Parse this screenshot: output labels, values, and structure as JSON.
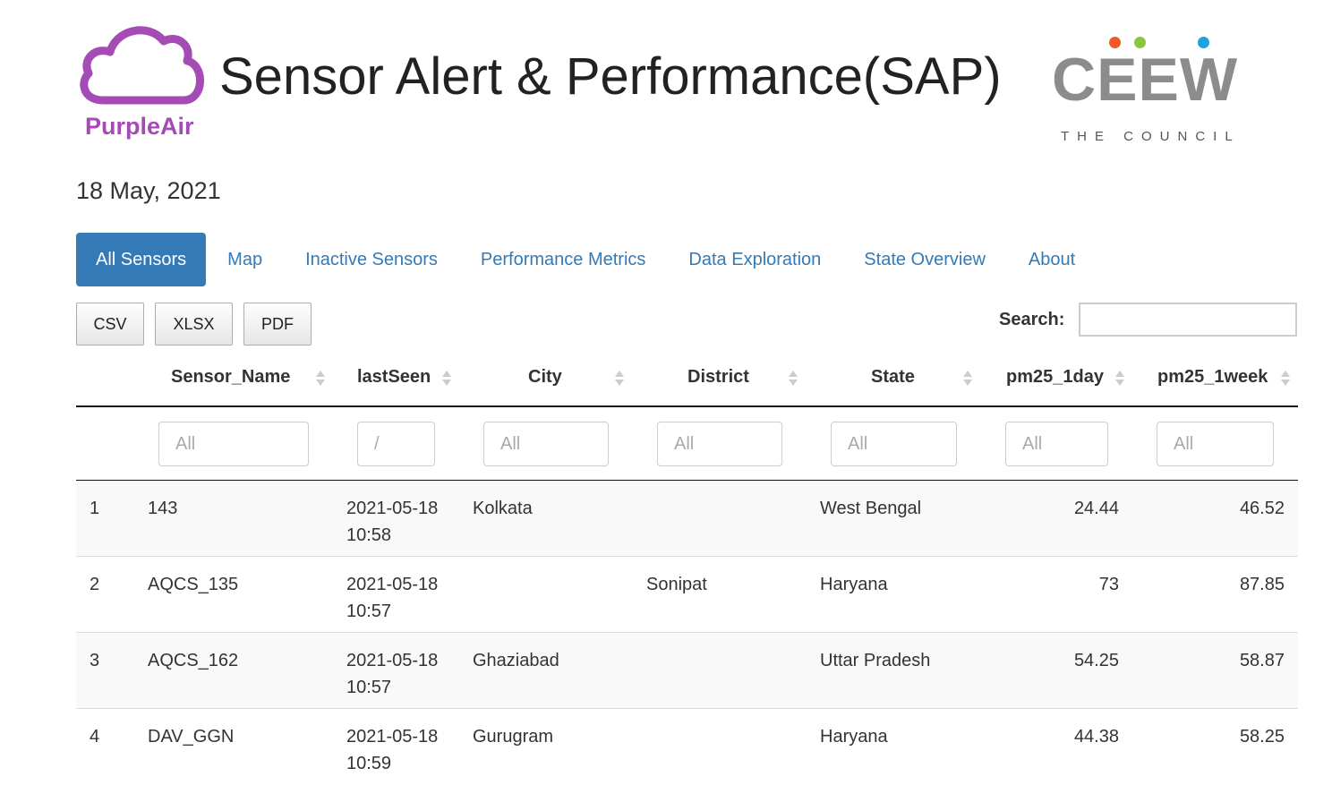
{
  "header": {
    "logo_left_text": "PurpleAir",
    "title": "Sensor Alert & Performance(SAP)",
    "logo_right_word": "CEEW",
    "logo_right_sub": "THE COUNCIL",
    "colors": {
      "purple": "#a54bb5",
      "ceew_grey": "#8c8c8c",
      "dot_orange": "#f05a28",
      "dot_green": "#8cc63f",
      "dot_blue": "#1da1e2"
    }
  },
  "date": "18 May, 2021",
  "tabs": [
    {
      "label": "All Sensors",
      "active": true
    },
    {
      "label": "Map"
    },
    {
      "label": "Inactive Sensors"
    },
    {
      "label": "Performance Metrics"
    },
    {
      "label": "Data Exploration"
    },
    {
      "label": "State Overview"
    },
    {
      "label": "About"
    }
  ],
  "buttons": {
    "csv": "CSV",
    "xlsx": "XLSX",
    "pdf": "PDF"
  },
  "search": {
    "label": "Search:",
    "value": ""
  },
  "table": {
    "columns": [
      "Sensor_Name",
      "lastSeen",
      "City",
      "District",
      "State",
      "pm25_1day",
      "pm25_1week"
    ],
    "filters": [
      "All",
      "/",
      "All",
      "All",
      "All",
      "All",
      "All"
    ],
    "rows": [
      {
        "index": "1",
        "name": "143",
        "date": "2021-05-18",
        "time": "10:58",
        "city": "Kolkata",
        "district": "",
        "state": "West Bengal",
        "pm1d": "24.44",
        "pm1w": "46.52"
      },
      {
        "index": "2",
        "name": "AQCS_135",
        "date": "2021-05-18",
        "time": "10:57",
        "city": "",
        "district": "Sonipat",
        "state": "Haryana",
        "pm1d": "73",
        "pm1w": "87.85"
      },
      {
        "index": "3",
        "name": "AQCS_162",
        "date": "2021-05-18",
        "time": "10:57",
        "city": "Ghaziabad",
        "district": "",
        "state": "Uttar Pradesh",
        "pm1d": "54.25",
        "pm1w": "58.87"
      },
      {
        "index": "4",
        "name": "DAV_GGN",
        "date": "2021-05-18",
        "time": "10:59",
        "city": "Gurugram",
        "district": "",
        "state": "Haryana",
        "pm1d": "44.38",
        "pm1w": "58.25"
      }
    ]
  }
}
